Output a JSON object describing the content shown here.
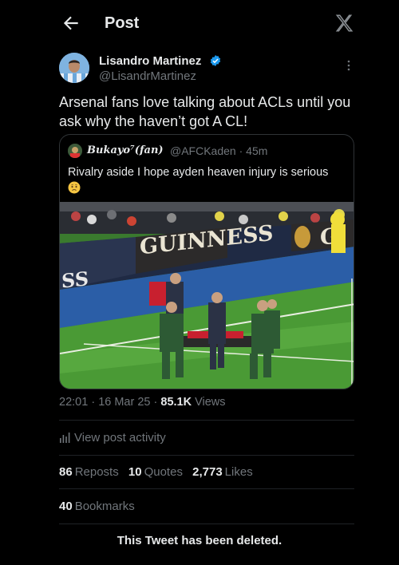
{
  "header": {
    "title": "Post",
    "back_icon": "arrow-left-icon",
    "logo_icon": "x-logo-icon"
  },
  "post": {
    "author_name": "Lisandro Martinez",
    "author_handle": "@LisandrMartinez",
    "text": "Arsenal fans love talking about ACLs until you ask why the haven’t got A CL!",
    "time": "22:01",
    "date": "16 Mar 25",
    "views_count": "85.1K",
    "views_label": "Views"
  },
  "quote": {
    "author_name": "Bukayo⁷(fan)",
    "author_handle": "@AFCKaden",
    "time_ago": "45m",
    "text": "Rivalry aside I hope ayden heaven injury is serious",
    "media_banner_text": "GUINNESS",
    "media_banner_left": "SS",
    "media_banner_right": "G"
  },
  "activity": {
    "label": "View post activity"
  },
  "stats": {
    "reposts_count": "86",
    "reposts_label": "Reposts",
    "quotes_count": "10",
    "quotes_label": "Quotes",
    "likes_count": "2,773",
    "likes_label": "Likes",
    "bookmarks_count": "40",
    "bookmarks_label": "Bookmarks"
  },
  "notice": {
    "deleted": "This Tweet has been deleted."
  },
  "colors": {
    "background": "#000000",
    "text_primary": "#e7e9ea",
    "text_secondary": "#71767b",
    "verified_blue": "#1d9bf0",
    "border": "#2f3336"
  }
}
